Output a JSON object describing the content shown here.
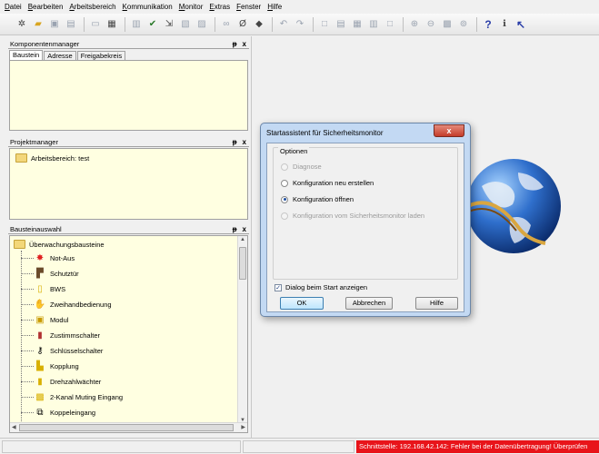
{
  "menu": [
    "Datei",
    "Bearbeiten",
    "Arbeitsbereich",
    "Kommunikation",
    "Monitor",
    "Extras",
    "Fenster",
    "Hilfe"
  ],
  "panels": {
    "komponentenmanager": {
      "title": "Komponentenmanager",
      "tabs": [
        "Baustein",
        "Adresse",
        "Freigabekreis"
      ]
    },
    "projektmanager": {
      "title": "Projektmanager",
      "root_item": "Arbeitsbereich: test"
    },
    "bausteinauswahl": {
      "title": "Bausteinauswahl",
      "root_item": "Überwachungsbausteine",
      "items": [
        "Not-Aus",
        "Schutztür",
        "BWS",
        "Zweihandbedienung",
        "Modul",
        "Zustimmschalter",
        "Schlüsselschalter",
        "Kopplung",
        "Drehzahlwächter",
        "2-Kanal Muting Eingang",
        "Koppeleingang"
      ]
    },
    "pin_glyph": "ᵽ",
    "close_glyph": "x"
  },
  "dialog": {
    "title": "Startassistent für Sicherheitsmonitor",
    "group_label": "Optionen",
    "options": [
      {
        "label": "Diagnose",
        "state": "disabled"
      },
      {
        "label": "Konfiguration neu erstellen",
        "state": "enabled"
      },
      {
        "label": "Konfiguration öffnen",
        "state": "selected"
      },
      {
        "label": "Konfiguration vom Sicherheitsmonitor laden",
        "state": "disabled"
      }
    ],
    "checkbox_label": "Dialog beim Start anzeigen",
    "checkbox_checked": true,
    "ok_label": "OK",
    "cancel_label": "Abbrechen",
    "help_label": "Hilfe",
    "close_glyph": "x"
  },
  "status": {
    "error_text": "Schnittstelle: 192.168.42.142: Fehler bei der Datenübertragung! Überprüfen"
  },
  "colors": {
    "panel_bg": "#ffffe1",
    "status_error": "#e8141a",
    "dialog_frame": "#c3d9f3"
  }
}
